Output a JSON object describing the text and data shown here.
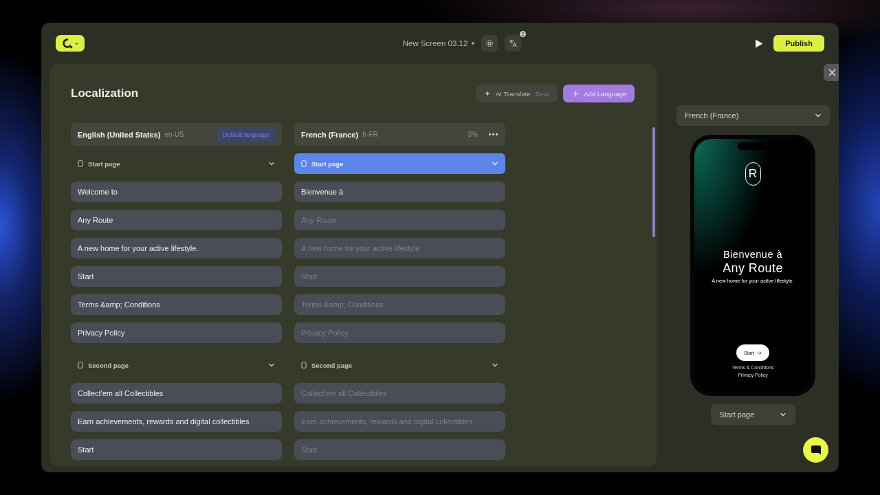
{
  "topbar": {
    "screen_title": "New Screen 03.12",
    "translate_badge": "2",
    "publish": "Publish"
  },
  "localization": {
    "title": "Localization",
    "ai_translate": {
      "label": "AI Translate",
      "badge": "Beta"
    },
    "add_language": "Add Language",
    "languages": [
      {
        "name": "English (United States)",
        "code": "en-US",
        "tag": "Default language",
        "sections": [
          {
            "title": "Start page",
            "selected": false,
            "fields": [
              {
                "value": "Welcome to"
              },
              {
                "value": "Any Route"
              },
              {
                "value": "A new home for your active lifestyle."
              },
              {
                "value": "Start"
              },
              {
                "value": "Terms &amp; Conditions"
              },
              {
                "value": "Privacy Policy"
              }
            ]
          },
          {
            "title": "Second page",
            "selected": false,
            "fields": [
              {
                "value": "Collect'em all Collectibles"
              },
              {
                "value": "Earn achievements, rewards and digital collectibles"
              },
              {
                "value": "Start"
              }
            ]
          }
        ]
      },
      {
        "name": "French (France)",
        "code": "fr-FR",
        "progress": "3%",
        "sections": [
          {
            "title": "Start page",
            "selected": true,
            "fields": [
              {
                "value": "Bienvenue à"
              },
              {
                "placeholder": "Any Route"
              },
              {
                "placeholder": "A new home for your active lifestyle"
              },
              {
                "placeholder": "Start"
              },
              {
                "placeholder": "Terms &amp; Conditions"
              },
              {
                "placeholder": "Privacy Policy"
              }
            ]
          },
          {
            "title": "Second page",
            "selected": false,
            "fields": [
              {
                "placeholder": "Collect'em all Collectibles"
              },
              {
                "placeholder": "Earn achievements, rewards and digital collectibles"
              },
              {
                "placeholder": "Start"
              }
            ]
          }
        ]
      }
    ]
  },
  "preview": {
    "language": "French (France)",
    "phone": {
      "logo_letter": "R",
      "title": "Bienvenue à",
      "headline": "Any Route",
      "subtitle": "A new home for your active lifestyle.",
      "button": "Start",
      "links": [
        "Terms & Conditions",
        "Privacy Policy"
      ]
    },
    "page": "Start page"
  }
}
